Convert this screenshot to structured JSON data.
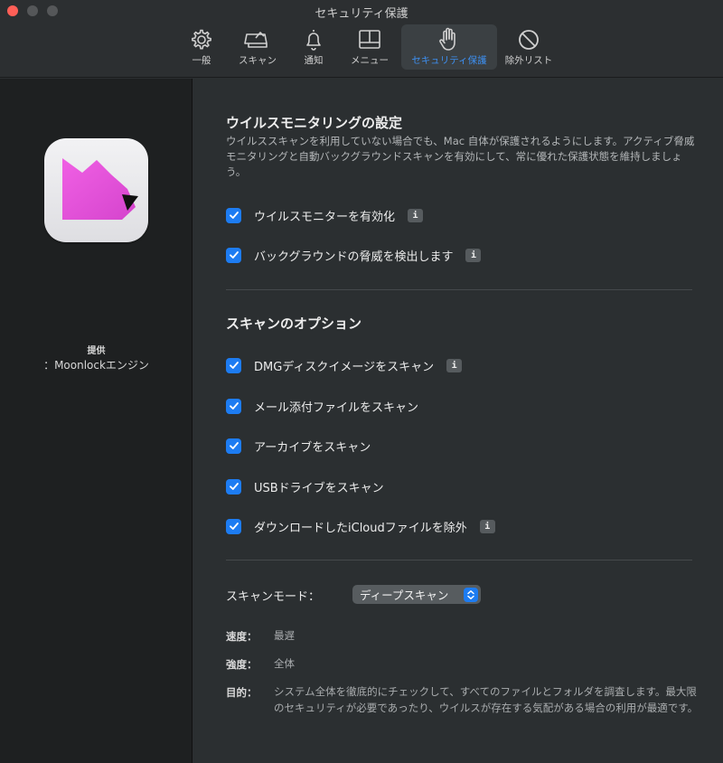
{
  "window": {
    "title": "セキュリティ保護"
  },
  "tabs": [
    {
      "icon": "gear-icon",
      "label": "一般"
    },
    {
      "icon": "scan-icon",
      "label": "スキャン"
    },
    {
      "icon": "bell-icon",
      "label": "通知"
    },
    {
      "icon": "menu-bar-icon",
      "label": "メニュー"
    },
    {
      "icon": "hand-icon",
      "label": "セキュリティ保護",
      "active": true
    },
    {
      "icon": "prohibited-icon",
      "label": "除外リスト"
    }
  ],
  "sidebar": {
    "provided_label": "提供",
    "engine_label": "：Moonlockエンジン"
  },
  "monitoring": {
    "title": "ウイルスモニタリングの設定",
    "description": "ウイルススキャンを利用していない場合でも、Mac 自体が保護されるようにします。アクティブ脅威モニタリングと自動バックグラウンドスキャンを有効にして、常に優れた保護状態を維持しましょう。",
    "options": [
      {
        "label": "ウイルスモニターを有効化",
        "checked": true,
        "info": "i"
      },
      {
        "label": "バックグラウンドの脅威を検出します",
        "checked": true,
        "info": "i"
      }
    ]
  },
  "scan_options": {
    "title": "スキャンのオプション",
    "options": [
      {
        "label": "DMGディスクイメージをスキャン",
        "checked": true,
        "info": "i"
      },
      {
        "label": "メール添付ファイルをスキャン",
        "checked": true
      },
      {
        "label": "アーカイブをスキャン",
        "checked": true
      },
      {
        "label": "USBドライブをスキャン",
        "checked": true
      },
      {
        "label": "ダウンロードしたiCloudファイルを除外",
        "checked": true,
        "info": "i"
      }
    ]
  },
  "scan_mode": {
    "label": "スキャンモード：",
    "selected": "ディープスキャン",
    "speed_key": "速度：",
    "speed_value": "最遅",
    "strength_key": "強度：",
    "strength_value": "全体",
    "purpose_key": "目的：",
    "purpose_value": "システム全体を徹底的にチェックして、すべてのファイルとフォルダを調査します。最大限のセキュリティが必要であったり、ウイルスが存在する気配がある場合の利用が最適です。"
  },
  "colors": {
    "accent": "#1d7cf2",
    "active_tab_text": "#3d8ff0",
    "app_icon_pink": "#e94fd9"
  }
}
